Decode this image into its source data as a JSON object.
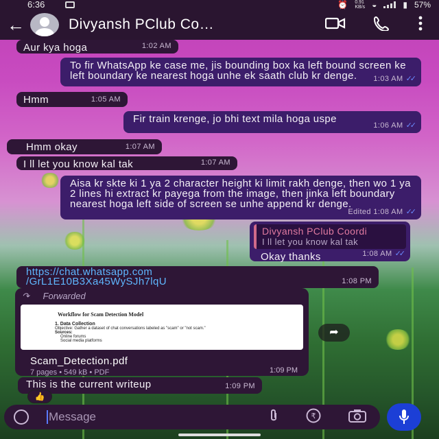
{
  "status_bar": {
    "time": "6:36",
    "net_speed": "0.91\nKB/s",
    "battery": "57%"
  },
  "header": {
    "title": "Divyansh PClub Co…"
  },
  "messages": [
    {
      "text": "Aur kya hoga",
      "time": "1:02 AM"
    },
    {
      "text": "To fir WhatsApp ke case me, jis bounding box ka left bound screen ke left boundary ke nearest hoga unhe ek saath club kr denge.",
      "time": "1:03 AM"
    },
    {
      "text": "Hmm",
      "time": "1:05 AM"
    },
    {
      "text": "Fir train krenge, jo bhi text mila hoga uspe",
      "time": "1:06 AM"
    },
    {
      "text": "Hmm okay",
      "time": "1:07 AM"
    },
    {
      "text": "I ll let you know kal tak",
      "time": "1:07 AM"
    },
    {
      "text": "Aisa kr skte ki 1 ya 2 character height ki limit rakh denge, then wo 1 ya 2 lines hi extract kr payega from the image, then jinka left boundary nearest hoga left side of screen se unhe append kr denge.",
      "time": "Edited  1:08 AM"
    },
    {
      "quote_name": "Divyansh PClub Coordi",
      "quote_text": "I ll let you know kal tak",
      "text": "Okay thanks",
      "time": "1:08 AM"
    },
    {
      "text": "https://chat.whatsapp.com\n/GrL1E10B3Xa45WySJh7lqU",
      "time": "1:08 PM"
    },
    {
      "forwarded": "Forwarded",
      "preview_title": "Workflow for Scam Detection Model",
      "preview_h": "1. Data Collection",
      "preview_obj": "Objective: Gather a dataset of chat conversations labeled as \"scam\" or \"not scam.\"",
      "preview_src": "Sources:",
      "preview_b1": "Online forums",
      "preview_b2": "Social media platforms",
      "doc_name": "Scam_Detection.pdf",
      "doc_info": "7 pages • 549 kB • PDF",
      "time": "1:09 PM"
    },
    {
      "text": "This is the current writeup",
      "time": "1:09 PM"
    }
  ],
  "reaction": "👍",
  "input": {
    "placeholder": "Message"
  },
  "colors": {
    "header_bg": "#2a1530",
    "incoming_bubble": "#2e1636",
    "outgoing_bubble": "#3c1d6a",
    "link": "#5fb7ff",
    "read_ticks": "#6a8bff",
    "mic_button": "#1c3fd6"
  },
  "icons": {
    "back": "arrow-left-icon",
    "video": "video-camera-icon",
    "call": "phone-icon",
    "menu": "more-vertical-icon",
    "emoji": "emoji-icon",
    "attach": "paperclip-icon",
    "payment": "rupee-icon",
    "camera": "camera-icon",
    "mic": "microphone-icon",
    "forward": "forward-icon",
    "share": "share-icon"
  }
}
